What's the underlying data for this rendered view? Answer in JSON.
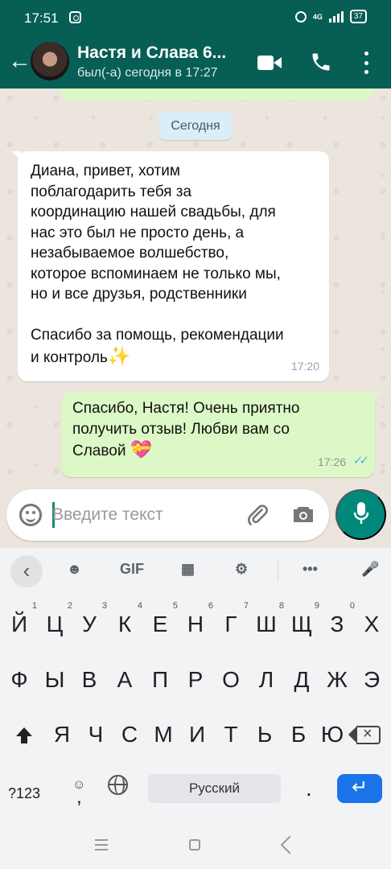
{
  "status_bar": {
    "time": "17:51",
    "network": "4G",
    "battery": "37"
  },
  "chat_header": {
    "title": "Настя и Слава 6...",
    "status": "был(-а) сегодня в 17:27"
  },
  "chat": {
    "date_chip": "Сегодня",
    "incoming": {
      "text": "Диана, привет, хотим\nпоблагодарить тебя за\nкоординацию нашей свадьбы, для\nнас это был не просто день, а\nнезабываемое волшебство,\nкоторое вспоминаем не только мы,\nно и все друзья, родственники\n\nСпасибо за помощь, рекомендации\nи контроль",
      "emoji": "✨",
      "time": "17:20"
    },
    "outgoing": {
      "text": "Спасибо, Настя! Очень приятно\nполучить отзыв! Любви вам со\nСлавой",
      "emoji": "💝",
      "time": "17:26",
      "ticks": "✓✓"
    }
  },
  "composer": {
    "placeholder": "Введите текст"
  },
  "keyboard": {
    "toolbar": {
      "collapse": "‹",
      "sticker": "☻",
      "gif": "GIF",
      "clipboard": "▦",
      "settings": "⚙",
      "more": "•••",
      "mic": "🎤"
    },
    "row1": [
      "Й",
      "Ц",
      "У",
      "К",
      "Е",
      "Н",
      "Г",
      "Ш",
      "Щ",
      "З",
      "Х"
    ],
    "row1_numbers": [
      "1",
      "2",
      "3",
      "4",
      "5",
      "6",
      "7",
      "8",
      "9",
      "0"
    ],
    "row2": [
      "Ф",
      "Ы",
      "В",
      "А",
      "П",
      "Р",
      "О",
      "Л",
      "Д",
      "Ж",
      "Э"
    ],
    "row3": [
      "Я",
      "Ч",
      "С",
      "М",
      "И",
      "Т",
      "Ь",
      "Б",
      "Ю"
    ],
    "bottom": {
      "numbers": "?123",
      "emoji": "☺",
      "comma": ",",
      "space": "Русский",
      "period": ".",
      "enter": "↵"
    }
  },
  "colors": {
    "header": "#075e54",
    "incoming": "#ffffff",
    "outgoing": "#dcf8c6",
    "accent": "#00897b"
  }
}
